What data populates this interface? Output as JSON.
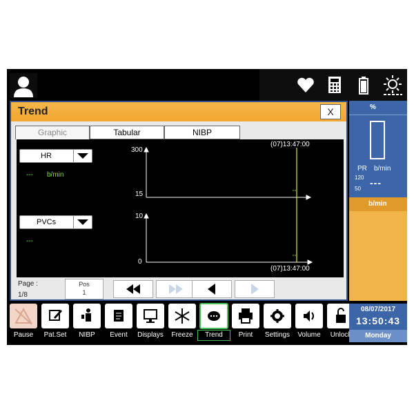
{
  "header": {
    "icons": [
      "user-avatar-icon",
      "heart-icon",
      "calculator-icon",
      "battery-icon",
      "brightness-icon"
    ]
  },
  "trend_window": {
    "title": "Trend",
    "close_label": "X",
    "tabs": [
      "Graphic",
      "Tabular",
      "NIBP"
    ],
    "active_tab": "Graphic",
    "graph": {
      "time_top": "(07)13:47:00",
      "time_bottom": "(07)13:47:00",
      "hr": {
        "param": "HR",
        "value": "---",
        "unit": "b/min",
        "y_max": "300",
        "y_min": "15"
      },
      "pvc": {
        "param": "PVCs",
        "value": "---",
        "y_max": "10",
        "y_min": "0"
      }
    },
    "page": {
      "label": "Page :",
      "value": "1/8",
      "pos_label": "Pos",
      "pos_value": "1"
    }
  },
  "right_panel": {
    "spo2_unit": "%",
    "pr_label": "PR",
    "pr_unit": "b/min",
    "pr_high": "120",
    "pr_low": "50",
    "pr_value": "---",
    "hr_unit": "b/min"
  },
  "bottom_bar": {
    "buttons": [
      {
        "label": "Pause",
        "icon": "pause-alarm-icon"
      },
      {
        "label": "Pat.Set",
        "icon": "edit-icon"
      },
      {
        "label": "NIBP",
        "icon": "nibp-icon"
      },
      {
        "label": "Event",
        "icon": "event-icon"
      },
      {
        "label": "Displays",
        "icon": "display-icon"
      },
      {
        "label": "Freeze",
        "icon": "freeze-icon"
      },
      {
        "label": "Trend",
        "icon": "trend-icon"
      },
      {
        "label": "Print",
        "icon": "print-icon"
      },
      {
        "label": "Settings",
        "icon": "gear-icon"
      },
      {
        "label": "Volume",
        "icon": "volume-icon"
      },
      {
        "label": "Unlock",
        "icon": "lock-icon"
      }
    ],
    "date": "08/07/2017",
    "time": "13:50:43",
    "day": "Monday"
  },
  "colors": {
    "title_bar": "#f1a72f",
    "right_panel_blue": "#3c66a8",
    "right_panel_orange": "#f1b44a",
    "cursor_line": "#e6e640",
    "value_green": "#88dd44"
  }
}
